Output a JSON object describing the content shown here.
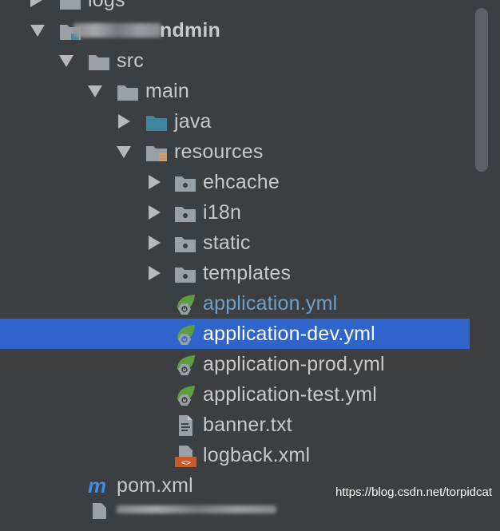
{
  "tree": {
    "logs": "logs",
    "project_suffix": "ndmin",
    "src": "src",
    "main": "main",
    "java": "java",
    "resources": "resources",
    "ehcache": "ehcache",
    "i18n": "i18n",
    "static": "static",
    "templates": "templates",
    "application_yml": "application.yml",
    "application_dev_yml": "application-dev.yml",
    "application_prod_yml": "application-prod.yml",
    "application_test_yml": "application-test.yml",
    "banner_txt": "banner.txt",
    "logback_xml": "logback.xml",
    "pom_icon_letter": "m",
    "pom_xml": "pom.xml"
  },
  "watermark": "https://blog.csdn.net/torpidcat",
  "colors": {
    "background": "#3c3f41",
    "selection": "#2f65ca",
    "text": "#c7cacd",
    "modified_text": "#6f9fc9",
    "folder": "#9aa1a6",
    "source_folder": "#3e86a0",
    "spring_leaf": "#5e9e3f"
  }
}
